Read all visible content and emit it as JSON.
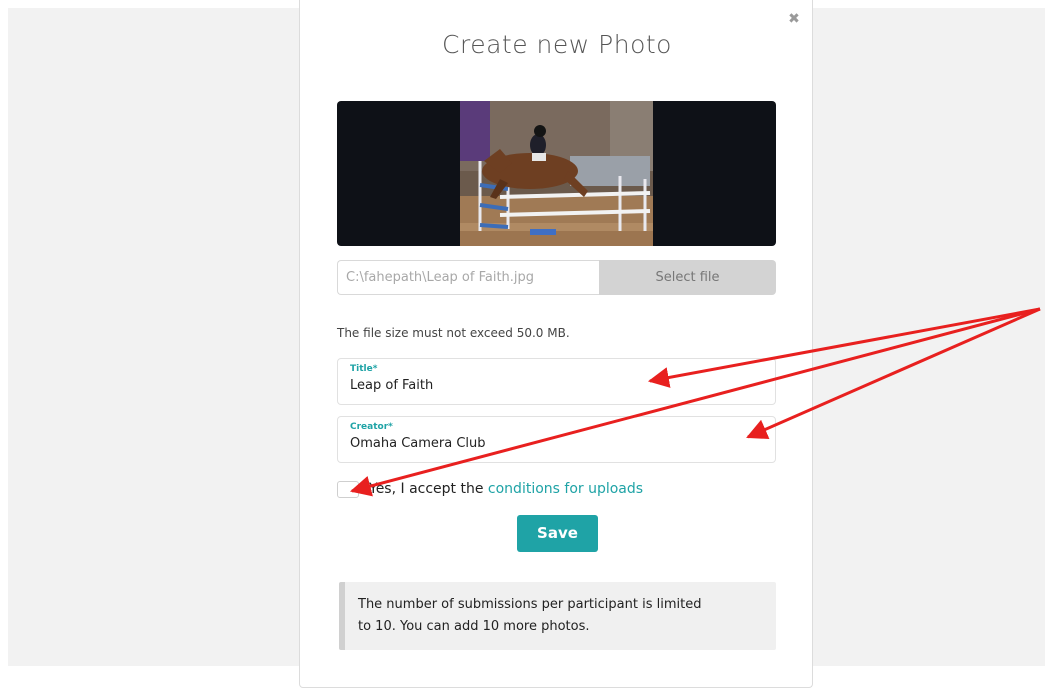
{
  "modal": {
    "title": "Create new Photo",
    "close_icon": "close-icon"
  },
  "upload": {
    "file_path": "C:\\fahepath\\Leap of Faith.jpg",
    "select_label": "Select file",
    "size_hint": "The file size must not exceed 50.0 MB."
  },
  "form": {
    "title_label": "Title*",
    "title_value": "Leap of Faith",
    "creator_label": "Creator*",
    "creator_value": "Omaha Camera Club"
  },
  "consent": {
    "checked": false,
    "text": "Yes, I accept the ",
    "link": "conditions for uploads"
  },
  "actions": {
    "save_label": "Save"
  },
  "info": {
    "line1": "The number of submissions per participant is limited",
    "line2": "to 10.  You can add 10 more photos."
  },
  "colors": {
    "accent": "#1fa3a6",
    "annotation": "#e8201f"
  }
}
